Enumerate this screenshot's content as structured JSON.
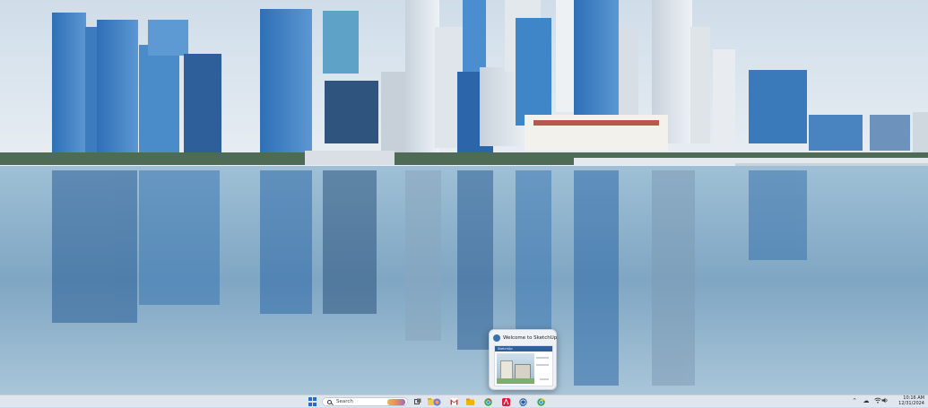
{
  "preview": {
    "title": "Welcome to SketchUp",
    "thumb_header": "SketchUp"
  },
  "taskbar": {
    "search_placeholder": "Search",
    "pinned_apps": [
      {
        "name": "task-view-icon",
        "color": "#555555"
      },
      {
        "name": "file-explorer-icon",
        "color": "#f2c94c"
      },
      {
        "name": "copilot-icon",
        "color": "#6a7bd8"
      },
      {
        "name": "gmail-icon",
        "color": "#d93025"
      },
      {
        "name": "files-icon",
        "color": "#f5b400"
      },
      {
        "name": "chrome-icon",
        "color": "#34a853"
      },
      {
        "name": "acrobat-icon",
        "color": "#e3183d"
      },
      {
        "name": "sketchup-icon",
        "color": "#2f5d9e"
      },
      {
        "name": "chrome-alt-icon",
        "color": "#34a853"
      }
    ],
    "clock": {
      "time": "10:16 AM",
      "date": "12/31/2024"
    }
  },
  "colors": {
    "accent": "#1f6fd1",
    "taskbar_bg": "#dfe6ee"
  }
}
